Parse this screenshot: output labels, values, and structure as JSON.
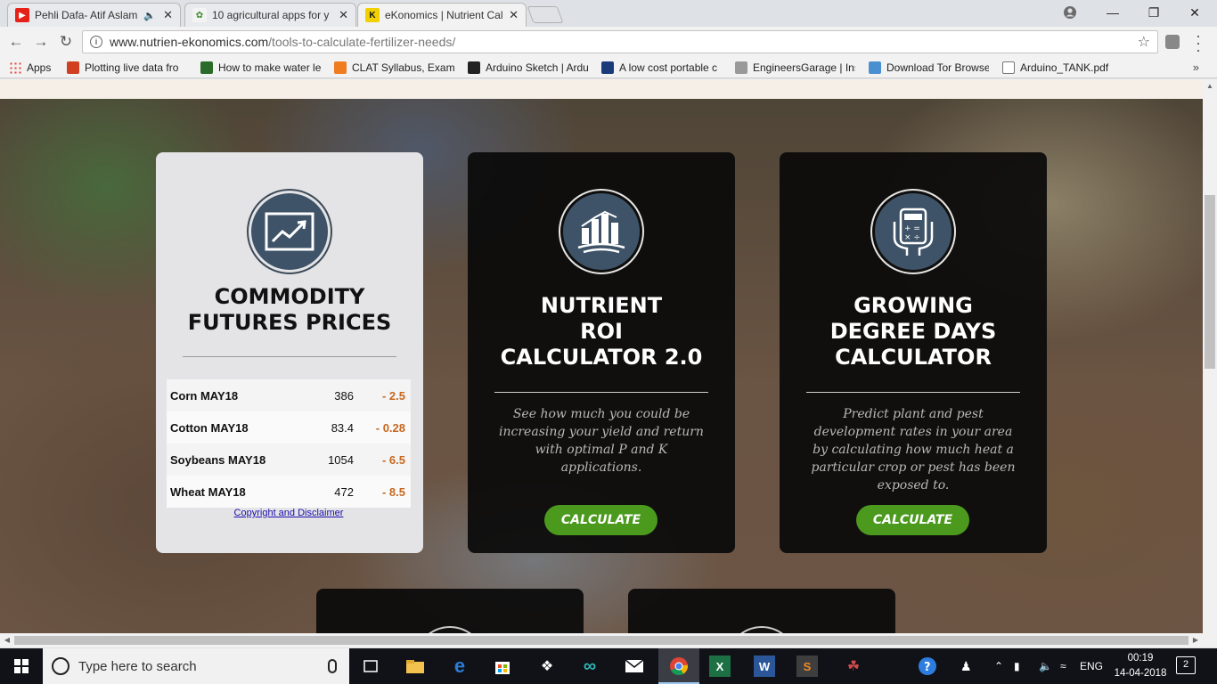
{
  "browser": {
    "tabs": [
      {
        "title": "Pehli Dafa- Atif Aslam",
        "favicon_color": "#e62117",
        "audio": true
      },
      {
        "title": "10 agricultural apps for y",
        "favicon_color": "#f3f3f3",
        "audio": false
      },
      {
        "title": "eKonomics | Nutrient Cal",
        "favicon_color": "#f0d000",
        "audio": false,
        "active": true
      }
    ],
    "url_host": "www.nutrien-ekonomics.com",
    "url_path": "/tools-to-calculate-fertilizer-needs/",
    "bookmarks": [
      {
        "label": "Apps",
        "icon_color": "#4285f4"
      },
      {
        "label": "Plotting live data fro",
        "icon_color": "#d04020"
      },
      {
        "label": "How to make water le",
        "icon_color": "#2a6a2a"
      },
      {
        "label": "CLAT Syllabus, Exam-",
        "icon_color": "#f07c20"
      },
      {
        "label": "Arduino Sketch | Ardu",
        "icon_color": "#222222"
      },
      {
        "label": "A low cost portable c",
        "icon_color": "#1a3a7a"
      },
      {
        "label": "EngineersGarage | Ins",
        "icon_color": "#888888"
      },
      {
        "label": "Download Tor Browse",
        "icon_color": "#4a90d0"
      },
      {
        "label": "Arduino_TANK.pdf",
        "icon_color": "#ffffff"
      }
    ]
  },
  "commodity": {
    "title_line1": "COMMODITY",
    "title_line2": "FUTURES PRICES",
    "rows": [
      {
        "name": "Corn MAY18",
        "price": "386",
        "change": "- 2.5"
      },
      {
        "name": "Cotton MAY18",
        "price": "83.4",
        "change": "- 0.28"
      },
      {
        "name": "Soybeans MAY18",
        "price": "1054",
        "change": "- 6.5"
      },
      {
        "name": "Wheat MAY18",
        "price": "472",
        "change": "- 8.5"
      }
    ],
    "copyright": "Copyright and Disclaimer"
  },
  "nutrient_roi": {
    "title_line1": "NUTRIENT",
    "title_line2": "ROI",
    "title_line3": "CALCULATOR 2.0",
    "description": "See how much you could be increasing your yield and return with optimal P and K applications.",
    "button": "CALCULATE"
  },
  "growing_degree": {
    "title_line1": "GROWING",
    "title_line2": "DEGREE DAYS",
    "title_line3": "CALCULATOR",
    "description": "Predict plant and pest development rates in your area by calculating how much heat a particular crop or pest has been exposed to.",
    "button": "CALCULATE"
  },
  "taskbar": {
    "search_placeholder": "Type here to search",
    "language": "ENG",
    "time": "00:19",
    "date": "14-04-2018",
    "notification_count": "2"
  },
  "colors": {
    "accent_green": "#4b9a1d",
    "change_orange": "#c8671f",
    "icon_blue": "#3e5368"
  }
}
